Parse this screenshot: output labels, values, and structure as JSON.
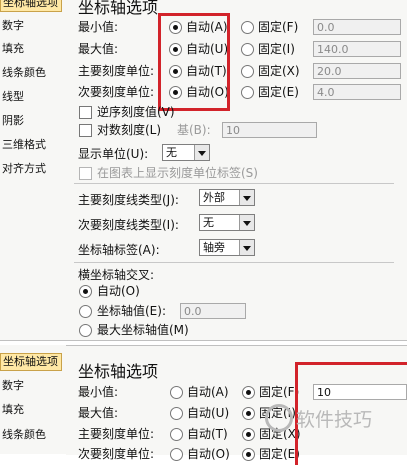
{
  "top": {
    "sidebar": [
      "坐标轴选项",
      "数字",
      "填充",
      "线条颜色",
      "线型",
      "阴影",
      "三维格式",
      "对齐方式"
    ],
    "title": "坐标轴选项",
    "rows": [
      {
        "label": "最小值:",
        "auto": "自动(A)",
        "fixed": "固定(F)",
        "value": "0.0"
      },
      {
        "label": "最大值:",
        "auto": "自动(U)",
        "fixed": "固定(I)",
        "value": "140.0"
      },
      {
        "label": "主要刻度单位:",
        "auto": "自动(T)",
        "fixed": "固定(X)",
        "value": "20.0"
      },
      {
        "label": "次要刻度单位:",
        "auto": "自动(O)",
        "fixed": "固定(E)",
        "value": "4.0"
      }
    ],
    "reverse_order": "逆序刻度值(V)",
    "log_scale": "对数刻度(L)",
    "base_label": "基(B):",
    "base_value": "10",
    "display_units_label": "显示单位(U):",
    "display_units_value": "无",
    "show_units_label": "在图表上显示刻度单位标签(S)",
    "major_tick_label": "主要刻度线类型(J):",
    "major_tick_value": "外部",
    "minor_tick_label": "次要刻度线类型(I):",
    "minor_tick_value": "无",
    "axis_label_label": "坐标轴标签(A):",
    "axis_label_value": "轴旁",
    "cross_title": "横坐标轴交叉:",
    "cross_auto": "自动(O)",
    "cross_value_label": "坐标轴值(E):",
    "cross_value": "0.0",
    "cross_max": "最大坐标轴值(M)"
  },
  "bottom": {
    "sidebar": [
      "坐标轴选项",
      "数字",
      "填充",
      "线条颜色"
    ],
    "title": "坐标轴选项",
    "rows": [
      {
        "label": "最小值:",
        "auto": "自动(A)",
        "fixed": "固定(F)",
        "value": "10"
      },
      {
        "label": "最大值:",
        "auto": "自动(U)",
        "fixed": "固定(I)"
      },
      {
        "label": "主要刻度单位:",
        "auto": "自动(T)",
        "fixed": "固定(X)"
      },
      {
        "label": "次要刻度单位:",
        "auto": "自动(O)",
        "fixed": "固定(E)"
      }
    ]
  },
  "watermark": "软件技巧",
  "colors": {
    "highlight": "#d2232a",
    "selected": "#ffe8a5"
  }
}
